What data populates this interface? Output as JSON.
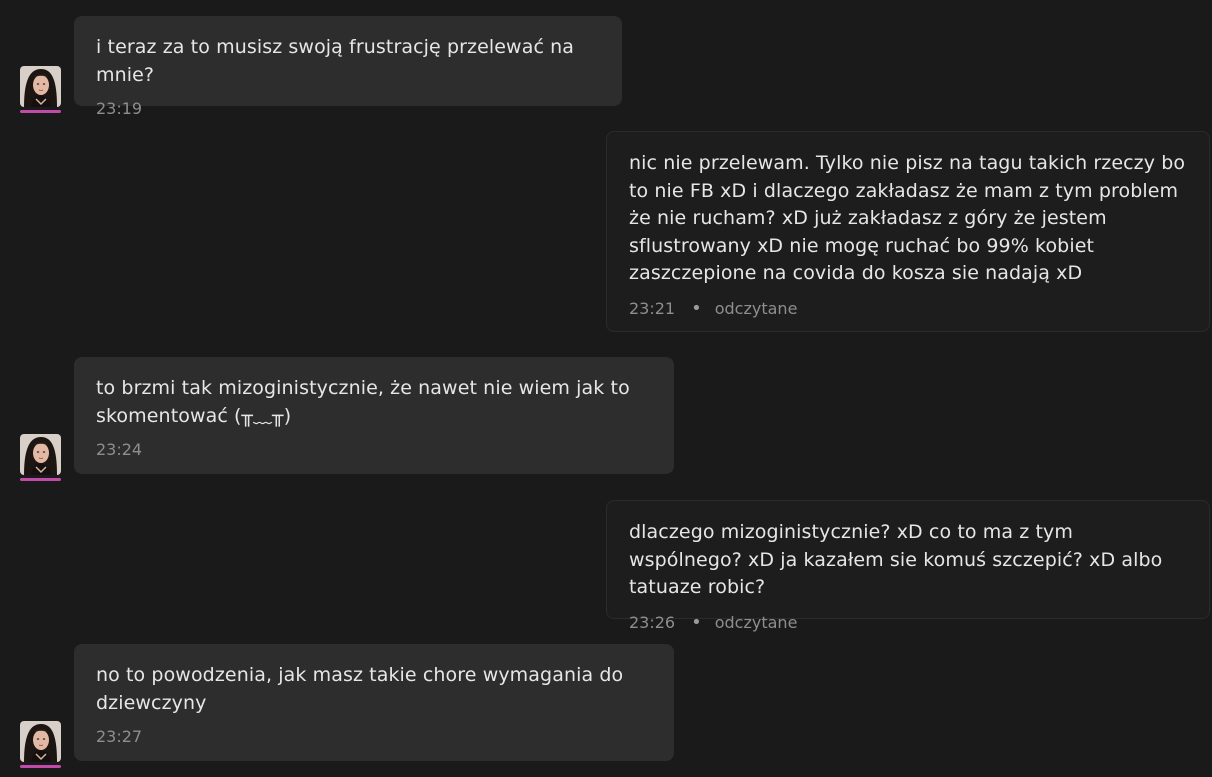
{
  "colors": {
    "background": "#1a1a1a",
    "incoming_bubble": "#2d2d2d",
    "outgoing_bubble": "#1d1d1d",
    "timestamp": "#8e8e8e",
    "avatar_accent": "#c24aa8"
  },
  "messages": [
    {
      "direction": "incoming",
      "text": "i teraz za to musisz swoją frustrację przelewać na mnie?",
      "time": "23:19"
    },
    {
      "direction": "outgoing",
      "text": "nic nie przelewam. Tylko nie pisz na tagu takich rzeczy bo to nie FB xD i dlaczego zakładasz że mam z tym problem że nie rucham? xD już zakładasz z góry że jestem sflustrowany xD nie mogę ruchać bo 99% kobiet zaszczepione na covida do kosza sie nadają xD",
      "time": "23:21",
      "status": "odczytane"
    },
    {
      "direction": "incoming",
      "text": "to brzmi tak mizoginistycznie, że nawet nie wiem jak to skomentować (╥﹏╥)",
      "time": "23:24"
    },
    {
      "direction": "outgoing",
      "text": "dlaczego mizoginistycznie? xD co to ma z tym wspólnego? xD ja kazałem sie komuś szczepić? xD albo tatuaze robic?",
      "time": "23:26",
      "status": "odczytane"
    },
    {
      "direction": "incoming",
      "text": "no to powodzenia, jak masz takie chore wymagania do dziewczyny",
      "time": "23:27"
    }
  ],
  "separator": "•",
  "avatar_icon": "user-avatar-photo"
}
